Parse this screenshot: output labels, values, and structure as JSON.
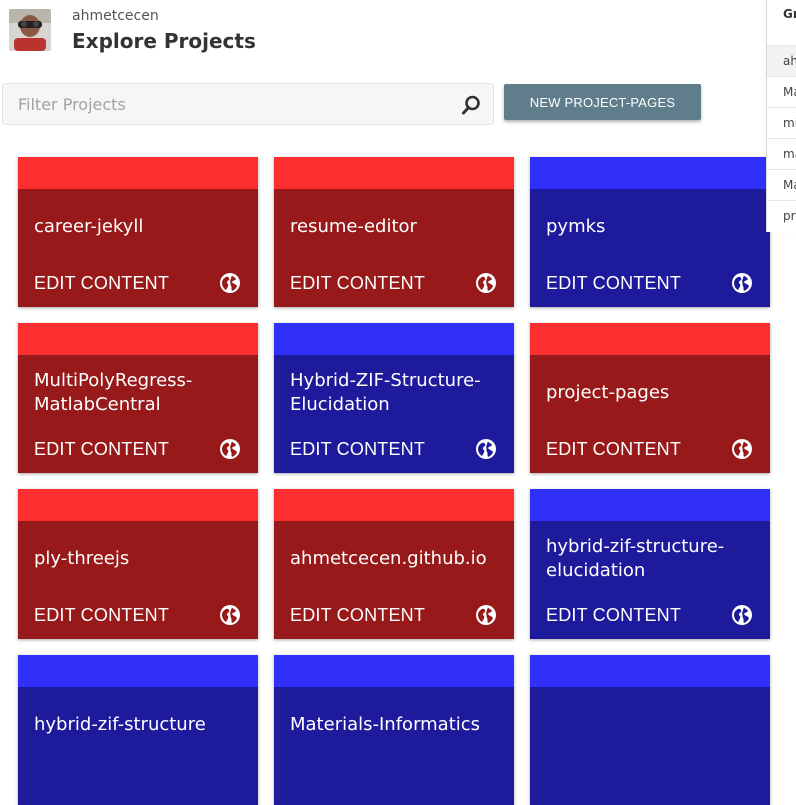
{
  "header": {
    "username": "ahmetcecen",
    "title": "Explore Projects"
  },
  "filter": {
    "placeholder": "Filter Projects",
    "value": ""
  },
  "new_button": {
    "label": "NEW PROJECT-PAGES"
  },
  "colors": {
    "red_top": "#fb2e30",
    "red_body": "#971919",
    "blue_top": "#3130fb",
    "blue_body": "#1e1a9c",
    "button": "#607d8b"
  },
  "projects": [
    {
      "name": "career-jekyll",
      "action": "EDIT CONTENT",
      "color": "red",
      "icon": "globe-icon"
    },
    {
      "name": "resume-editor",
      "action": "EDIT CONTENT",
      "color": "red",
      "icon": "globe-icon"
    },
    {
      "name": "pymks",
      "action": "EDIT CONTENT",
      "color": "blue",
      "icon": "globe-icon"
    },
    {
      "name": "MultiPolyRegress-MatlabCentral",
      "action": "EDIT CONTENT",
      "color": "red",
      "icon": "globe-icon"
    },
    {
      "name": "Hybrid-ZIF-Structure-Elucidation",
      "action": "EDIT CONTENT",
      "color": "blue",
      "icon": "globe-icon"
    },
    {
      "name": "project-pages",
      "action": "EDIT CONTENT",
      "color": "red",
      "icon": "globe-icon"
    },
    {
      "name": "ply-threejs",
      "action": "EDIT CONTENT",
      "color": "red",
      "icon": "globe-icon"
    },
    {
      "name": "ahmetcecen.github.io",
      "action": "EDIT CONTENT",
      "color": "red",
      "icon": "globe-icon"
    },
    {
      "name": "hybrid-zif-structure-elucidation",
      "action": "EDIT CONTENT",
      "color": "blue",
      "icon": "globe-icon"
    },
    {
      "name": "hybrid-zif-structure",
      "action": "",
      "color": "blue",
      "icon": ""
    },
    {
      "name": "Materials-Informatics",
      "action": "",
      "color": "blue",
      "icon": ""
    },
    {
      "name": "",
      "action": "",
      "color": "blue",
      "icon": ""
    }
  ],
  "right_panel": {
    "heading": "Gr",
    "items": [
      "ah",
      "Ma",
      "mi",
      "ma",
      "Ma",
      "pr"
    ]
  }
}
